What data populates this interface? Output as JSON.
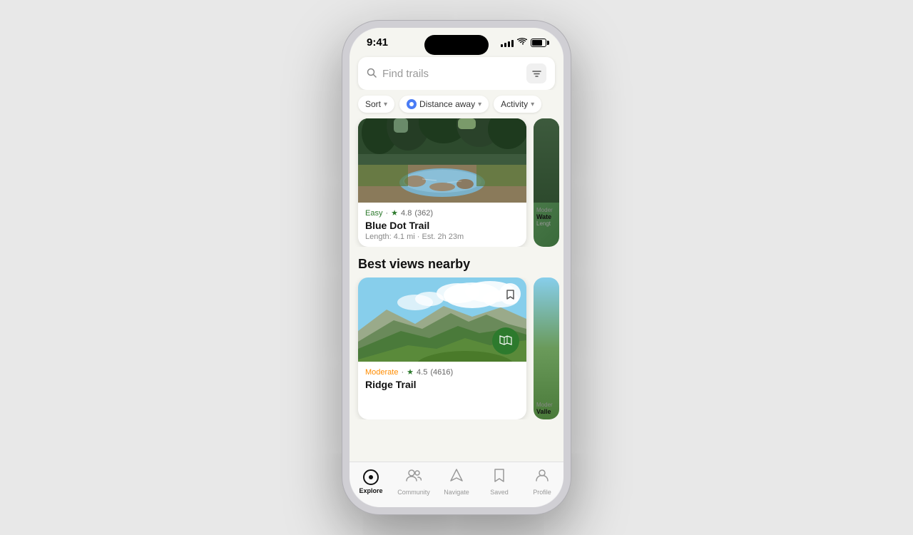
{
  "phone": {
    "time": "9:41",
    "battery_level": 80
  },
  "search": {
    "placeholder": "Find trails",
    "filter_icon": "⊞"
  },
  "filters": {
    "sort_label": "Sort",
    "distance_label": "Distance away",
    "activity_label": "Activity"
  },
  "first_card": {
    "difficulty": "Easy",
    "rating": "4.8",
    "review_count": "(362)",
    "title": "Blue Dot Trail",
    "length": "Length:  4.1 mi · Est. 2h 23m"
  },
  "first_card_partial": {
    "difficulty": "Moder...",
    "title": "Wate...",
    "length": "Lengt..."
  },
  "section_title": "Best views nearby",
  "second_card": {
    "difficulty": "Moderate",
    "rating": "4.5",
    "review_count": "(4616)",
    "title": "Ridge Trail"
  },
  "second_card_partial": {
    "difficulty": "Moder...",
    "title": "Valle..."
  },
  "nav": {
    "explore": "Explore",
    "community": "Community",
    "navigate": "Navigate",
    "saved": "Saved",
    "profile": "Profile"
  }
}
